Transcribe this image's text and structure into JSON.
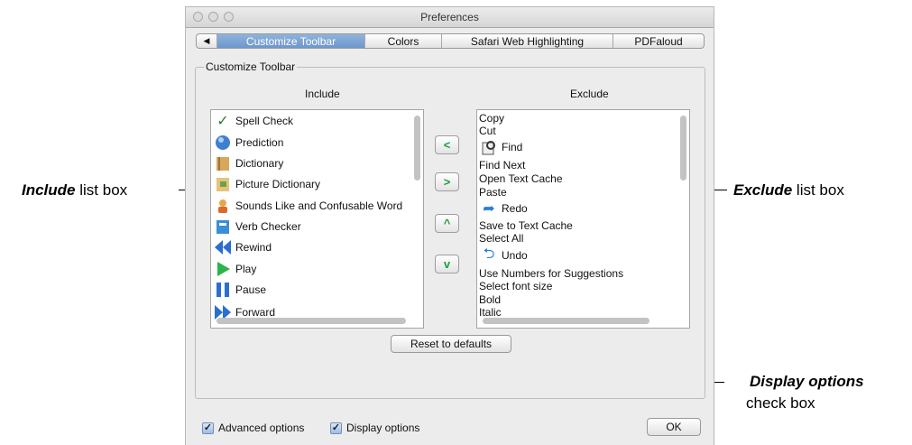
{
  "window": {
    "title": "Preferences"
  },
  "tabs": [
    {
      "label": "◀"
    },
    {
      "label": "Customize Toolbar"
    },
    {
      "label": "Colors"
    },
    {
      "label": "Safari Web Highlighting"
    },
    {
      "label": "PDFaloud"
    }
  ],
  "group": {
    "label": "Customize Toolbar",
    "include_header": "Include",
    "exclude_header": "Exclude"
  },
  "include_items": [
    {
      "label": "Spell Check",
      "icon": "spell-check-icon"
    },
    {
      "label": "Prediction",
      "icon": "prediction-icon"
    },
    {
      "label": "Dictionary",
      "icon": "dictionary-icon"
    },
    {
      "label": "Picture Dictionary",
      "icon": "picture-dictionary-icon"
    },
    {
      "label": "Sounds Like and Confusable Word",
      "icon": "sounds-like-icon"
    },
    {
      "label": "Verb Checker",
      "icon": "verb-checker-icon"
    },
    {
      "label": "Rewind",
      "icon": "rewind-icon"
    },
    {
      "label": "Play",
      "icon": "play-icon"
    },
    {
      "label": "Pause",
      "icon": "pause-icon"
    },
    {
      "label": "Forward",
      "icon": "forward-icon"
    }
  ],
  "exclude_items": [
    {
      "label": "Copy"
    },
    {
      "label": "Cut"
    },
    {
      "label": "Find",
      "icon": "find-icon"
    },
    {
      "label": "Find Next"
    },
    {
      "label": "Open Text Cache"
    },
    {
      "label": "Paste"
    },
    {
      "label": "Redo",
      "icon": "redo-icon"
    },
    {
      "label": "Save to Text Cache"
    },
    {
      "label": "Select All"
    },
    {
      "label": "Undo",
      "icon": "undo-icon"
    },
    {
      "label": "Use Numbers for Suggestions"
    },
    {
      "label": "Select font size"
    },
    {
      "label": "Bold"
    },
    {
      "label": "Italic"
    }
  ],
  "arrows": {
    "left": "<",
    "right": ">",
    "up": "^",
    "down": "v"
  },
  "buttons": {
    "reset": "Reset to defaults",
    "ok": "OK"
  },
  "checkboxes": {
    "advanced": {
      "label": "Advanced options",
      "checked": true
    },
    "display": {
      "label": "Display options",
      "checked": true
    }
  },
  "callouts": {
    "include_bold": "Include",
    "include_rest": " list box",
    "exclude_bold": "Exclude",
    "exclude_rest": " list box",
    "display_bold": "Display options",
    "display_rest": "check box"
  }
}
